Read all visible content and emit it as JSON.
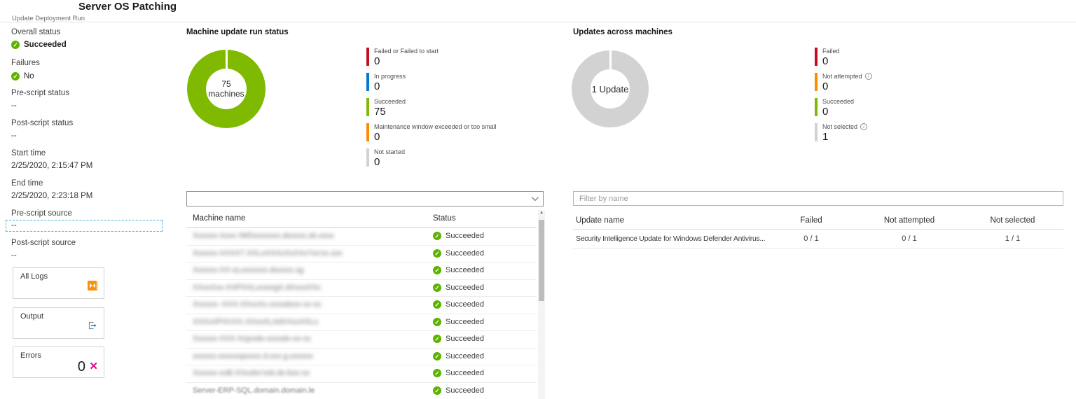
{
  "header": {
    "title": "Server OS Patching",
    "subtitle": "Update Deployment Run"
  },
  "colors": {
    "green": "#7fba00",
    "check_green": "#5db300",
    "red": "#c10e21",
    "blue": "#0078d4",
    "orange": "#ff8c00",
    "neutral_gray": "#d2d2d2",
    "magenta": "#e3008c",
    "tile_orange": "#f7920e",
    "focus_blue": "#3db1e4"
  },
  "icons": {
    "check": "✓",
    "error_x": "✕",
    "info": "i",
    "scroll_up": "▲"
  },
  "sidebar": {
    "overall_status": {
      "label": "Overall status",
      "value": "Succeeded"
    },
    "failures": {
      "label": "Failures",
      "value": "No"
    },
    "pre_script_status": {
      "label": "Pre-script status",
      "value": "--"
    },
    "post_script_status": {
      "label": "Post-script status",
      "value": "--"
    },
    "start_time": {
      "label": "Start time",
      "value": "2/25/2020, 2:15:47 PM"
    },
    "end_time": {
      "label": "End time",
      "value": "2/25/2020, 2:23:18 PM"
    },
    "pre_script_source": {
      "label": "Pre-script source",
      "value": "--"
    },
    "post_script_source": {
      "label": "Post-script source",
      "value": "--"
    },
    "tiles": {
      "all_logs": {
        "label": "All Logs"
      },
      "output": {
        "label": "Output"
      },
      "errors": {
        "label": "Errors",
        "count": "0"
      }
    }
  },
  "machine_chart": {
    "type": "donut",
    "title": "Machine update run status",
    "center": {
      "value": "75",
      "unit": "machines"
    },
    "total": 75,
    "segments": [
      {
        "label": "Succeeded",
        "value": 75,
        "color": "#7fba00"
      }
    ],
    "legend": [
      {
        "label": "Failed or Failed to start",
        "value": "0",
        "color": "#c10e21"
      },
      {
        "label": "In progress",
        "value": "0",
        "color": "#0078d4"
      },
      {
        "label": "Succeeded",
        "value": "75",
        "color": "#7fba00"
      },
      {
        "label": "Maintenance window exceeded or too small",
        "value": "0",
        "color": "#ff8c00"
      },
      {
        "label": "Not started",
        "value": "0",
        "color": "#d2d2d2"
      }
    ]
  },
  "updates_chart": {
    "type": "donut",
    "title": "Updates across machines",
    "center": {
      "value": "1 Update"
    },
    "total": 1,
    "segments": [
      {
        "label": "Not selected",
        "value": 1,
        "color": "#d2d2d2"
      }
    ],
    "legend": [
      {
        "label": "Failed",
        "value": "0",
        "color": "#c10e21"
      },
      {
        "label": "Not attempted",
        "value": "0",
        "color": "#ff8c00"
      },
      {
        "label": "Succeeded",
        "value": "0",
        "color": "#7fba00"
      },
      {
        "label": "Not selected",
        "value": "1",
        "color": "#d2d2d2"
      }
    ]
  },
  "machine_table": {
    "dropdown_value": "",
    "columns": {
      "name": "Machine name",
      "status": "Status"
    },
    "rows": [
      {
        "name": "Xxxxxx-Xxxx IWDxxxxxxx.dxxxxx.xb.xxxx",
        "status": "Succeeded"
      },
      {
        "name": "Xxxxxx-XXXX7.XXLxXXXxXxXXx7xx'xx.xxx",
        "status": "Succeeded"
      },
      {
        "name": "Xxxxxx-XX-xLxxxxxxx.dxxxxx.xg",
        "status": "Succeeded"
      },
      {
        "name": "XXxxXxx-XXPXXLxxxxrgX.dXxxxXXx",
        "status": "Succeeded"
      },
      {
        "name": "Xxxxxx--XXX-XXxxXx.xxxxdxxx-xx-xx",
        "status": "Succeeded"
      },
      {
        "name": "XXXxXPXVXX.XXxxXLXdXXxxXXLx",
        "status": "Succeeded"
      },
      {
        "name": "Xxxxxx-XXX-Xxjxxdx-xxxxdx-xx-xx",
        "status": "Succeeded"
      },
      {
        "name": "xxxxxx-xxxxxxpxxxx.d.xxx.g.xxxxxx",
        "status": "Succeeded"
      },
      {
        "name": "Xxxxxx-xxB-XXxxbx'xxb.dx-bxx-xx",
        "status": "Succeeded"
      },
      {
        "name": "Server-ERP-SQL.domain.domain.le",
        "status": "Succeeded"
      }
    ]
  },
  "updates_table": {
    "filter_placeholder": "Filter by name",
    "columns": {
      "name": "Update name",
      "failed": "Failed",
      "not_attempted": "Not attempted",
      "not_selected": "Not selected"
    },
    "rows": [
      {
        "name": "Security Intelligence Update for Windows Defender Antivirus...",
        "failed": "0 / 1",
        "not_attempted": "0 / 1",
        "not_selected": "1 / 1"
      }
    ]
  }
}
